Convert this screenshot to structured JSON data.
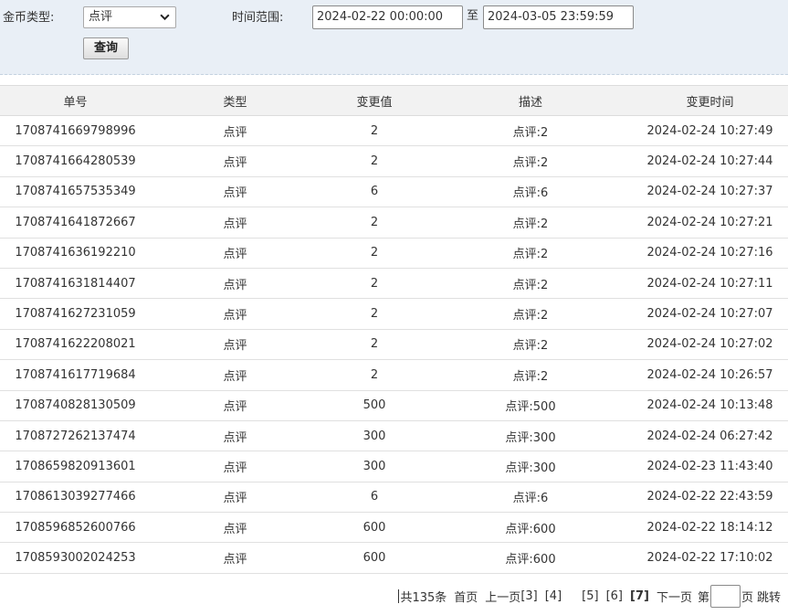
{
  "filters": {
    "coin_type_label": "金币类型:",
    "coin_type_selected": "点评",
    "time_range_label": "时间范围:",
    "start_time": "2024-02-22 00:00:00",
    "to_label": "至",
    "end_time": "2024-03-05 23:59:59",
    "query_button": "查询"
  },
  "table": {
    "headers": [
      "单号",
      "类型",
      "变更值",
      "描述",
      "变更时间"
    ],
    "rows": [
      [
        "1708741669798996",
        "点评",
        "2",
        "点评:2",
        "2024-02-24 10:27:49"
      ],
      [
        "1708741664280539",
        "点评",
        "2",
        "点评:2",
        "2024-02-24 10:27:44"
      ],
      [
        "1708741657535349",
        "点评",
        "6",
        "点评:6",
        "2024-02-24 10:27:37"
      ],
      [
        "1708741641872667",
        "点评",
        "2",
        "点评:2",
        "2024-02-24 10:27:21"
      ],
      [
        "1708741636192210",
        "点评",
        "2",
        "点评:2",
        "2024-02-24 10:27:16"
      ],
      [
        "1708741631814407",
        "点评",
        "2",
        "点评:2",
        "2024-02-24 10:27:11"
      ],
      [
        "1708741627231059",
        "点评",
        "2",
        "点评:2",
        "2024-02-24 10:27:07"
      ],
      [
        "1708741622208021",
        "点评",
        "2",
        "点评:2",
        "2024-02-24 10:27:02"
      ],
      [
        "1708741617719684",
        "点评",
        "2",
        "点评:2",
        "2024-02-24 10:26:57"
      ],
      [
        "1708740828130509",
        "点评",
        "500",
        "点评:500",
        "2024-02-24 10:13:48"
      ],
      [
        "1708727262137474",
        "点评",
        "300",
        "点评:300",
        "2024-02-24 06:27:42"
      ],
      [
        "1708659820913601",
        "点评",
        "300",
        "点评:300",
        "2024-02-23 11:43:40"
      ],
      [
        "1708613039277466",
        "点评",
        "6",
        "点评:6",
        "2024-02-22 22:43:59"
      ],
      [
        "1708596852600766",
        "点评",
        "600",
        "点评:600",
        "2024-02-22 18:14:12"
      ],
      [
        "1708593002024253",
        "点评",
        "600",
        "点评:600",
        "2024-02-22 17:10:02"
      ]
    ]
  },
  "pagination": {
    "total": "共135条",
    "first": "首页",
    "prev": "上一页",
    "pages": [
      "[3]",
      "[4]",
      "[5]",
      "[6]"
    ],
    "current": "[7]",
    "next": "下一页",
    "goto_prefix": "第",
    "goto_suffix": "页",
    "jump": "跳转"
  }
}
